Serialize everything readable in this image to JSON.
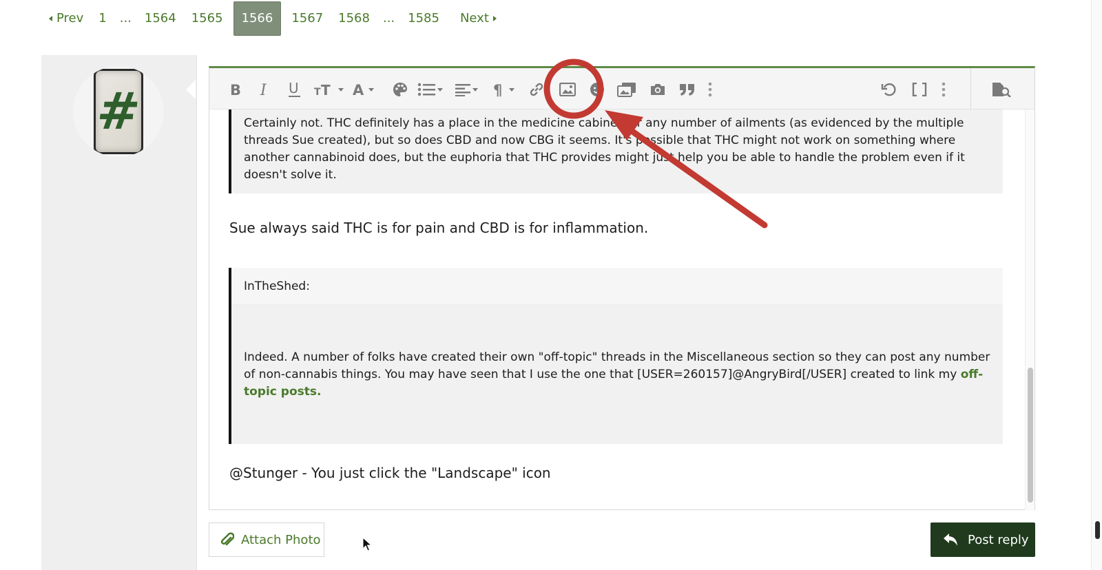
{
  "pagination": {
    "prev": "Prev",
    "pages": [
      "1",
      "...",
      "1564",
      "1565",
      "1566",
      "1567",
      "1568",
      "...",
      "1585"
    ],
    "current": "1566",
    "next": "Next"
  },
  "editor": {
    "toolbar_icons": [
      "bold-icon",
      "italic-icon",
      "underline-icon",
      "font-size-icon",
      "font-family-icon",
      "color-palette-icon",
      "list-icon",
      "align-icon",
      "paragraph-icon",
      "link-icon",
      "insert-image-icon",
      "smilie-icon",
      "gallery-icon",
      "camera-icon",
      "quote-icon",
      "more-icon",
      "undo-icon",
      "bbcode-toggle-icon",
      "more-options-icon",
      "preview-icon"
    ],
    "quote1_text": "Certainly not.  THC definitely has a place in the medicine cabinet for any number of ailments (as evidenced by the multiple threads Sue created), but so does CBD and now CBG it seems.  It's possible that THC might not work on something where another cannabinoid does, but the euphoria that THC provides might just help you be able to handle  the problem even if it doesn't solve it.",
    "line1": "Sue always said THC is for pain and CBD is for inflammation.",
    "quote2_author": "InTheShed:",
    "quote2_text": "Indeed. A number of folks have created their own \"off-topic\" threads in the Miscellaneous section so they can post any number of non-cannabis things.  You may have seen that I use the one that [USER=260157]@AngryBird[/USER] created to link my ",
    "quote2_link": "off-topic posts.",
    "line2": "@Stunger - You just click the \"Landscape\" icon"
  },
  "buttons": {
    "attach": "Attach Photo",
    "post": "Post reply"
  },
  "colors": {
    "accent_green": "#4a7a2b",
    "post_button": "#1f3a1c",
    "annotation_red": "#c23a32",
    "current_page_bg": "#7f8f7a"
  }
}
